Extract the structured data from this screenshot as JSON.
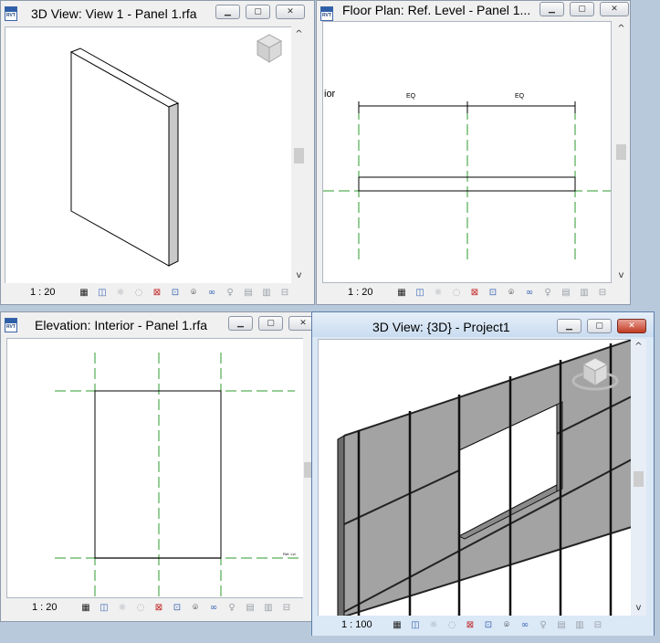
{
  "colors": {
    "grid_line": "#2c9b2c",
    "panel_fill": "#a3a3a3",
    "active_title": "#c9dcf0"
  },
  "window_controls": {
    "minimize": "▁",
    "maximize": "▢",
    "close": "✕"
  },
  "app_icon_label": "RVT",
  "scrollbar": {
    "up": "^",
    "down": "v"
  },
  "windows": {
    "view_3d_panel": {
      "title": "3D View: View 1 - Panel 1.rfa",
      "scale": "1 : 20"
    },
    "floor_plan": {
      "title": "Floor Plan: Ref. Level - Panel 1...",
      "scale": "1 : 20",
      "dimension_left": "EQ",
      "dimension_right": "EQ",
      "clipped_label": "ior"
    },
    "elevation": {
      "title": "Elevation: Interior - Panel 1.rfa",
      "scale": "1 : 20",
      "clipped_tag": "Ref. Lvl"
    },
    "view_3d_project": {
      "title": "3D View: {3D} - Project1",
      "scale": "1 : 100"
    }
  },
  "status_icons": [
    {
      "name": "detail-level-icon",
      "glyph": "▦",
      "tone": "dark"
    },
    {
      "name": "visual-style-icon",
      "glyph": "◫",
      "tone": "blue"
    },
    {
      "name": "sun-path-icon",
      "glyph": "☼",
      "tone": "dim"
    },
    {
      "name": "shadows-icon",
      "glyph": "◌",
      "tone": "dim"
    },
    {
      "name": "crop-region-icon",
      "glyph": "⊠",
      "tone": "red"
    },
    {
      "name": "show-crop-icon",
      "glyph": "⊡",
      "tone": "blue"
    },
    {
      "name": "temporary-hide-icon",
      "glyph": "⌾",
      "tone": "dark"
    },
    {
      "name": "reveal-hidden-icon",
      "glyph": "∞",
      "tone": "blue"
    },
    {
      "name": "lightbulb-icon",
      "glyph": "♀",
      "tone": "dim"
    },
    {
      "name": "temporary-view-icon",
      "glyph": "▤",
      "tone": "dim"
    },
    {
      "name": "analysis-icon",
      "glyph": "▥",
      "tone": "dim"
    },
    {
      "name": "constraints-icon",
      "glyph": "⊟",
      "tone": "dim"
    }
  ]
}
